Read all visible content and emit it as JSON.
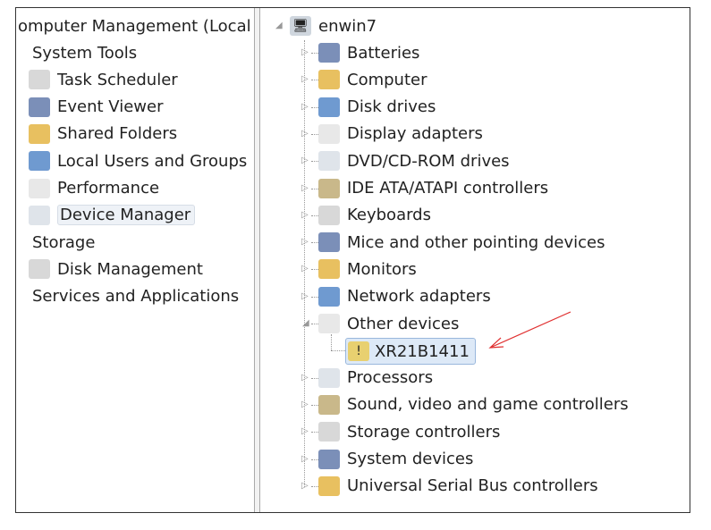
{
  "left_tree": {
    "root": "omputer Management (Local",
    "items": [
      {
        "label": "System Tools",
        "level": 0,
        "icon": "tools-icon"
      },
      {
        "label": "Task Scheduler",
        "level": 1,
        "icon": "clock-icon"
      },
      {
        "label": "Event Viewer",
        "level": 1,
        "icon": "event-viewer-icon"
      },
      {
        "label": "Shared Folders",
        "level": 1,
        "icon": "shared-folder-icon"
      },
      {
        "label": "Local Users and Groups",
        "level": 1,
        "icon": "users-icon"
      },
      {
        "label": "Performance",
        "level": 1,
        "icon": "performance-icon"
      },
      {
        "label": "Device Manager",
        "level": 1,
        "icon": "device-manager-icon",
        "selected": true
      },
      {
        "label": "Storage",
        "level": 0,
        "icon": "storage-icon"
      },
      {
        "label": "Disk Management",
        "level": 1,
        "icon": "disk-icon"
      },
      {
        "label": "Services and Applications",
        "level": 0,
        "icon": "services-icon"
      }
    ]
  },
  "device_tree": {
    "root": "enwin7",
    "categories": [
      {
        "label": "Batteries",
        "icon": "battery-icon"
      },
      {
        "label": "Computer",
        "icon": "computer-icon"
      },
      {
        "label": "Disk drives",
        "icon": "disk-drive-icon"
      },
      {
        "label": "Display adapters",
        "icon": "display-adapter-icon"
      },
      {
        "label": "DVD/CD-ROM drives",
        "icon": "dvd-icon"
      },
      {
        "label": "IDE ATA/ATAPI controllers",
        "icon": "ide-icon"
      },
      {
        "label": "Keyboards",
        "icon": "keyboard-icon"
      },
      {
        "label": "Mice and other pointing devices",
        "icon": "mouse-icon"
      },
      {
        "label": "Monitors",
        "icon": "monitor-icon"
      },
      {
        "label": "Network adapters",
        "icon": "network-icon"
      },
      {
        "label": "Other devices",
        "icon": "unknown-device-icon",
        "expanded": true
      },
      {
        "label": "Processors",
        "icon": "processor-icon"
      },
      {
        "label": "Sound, video and game controllers",
        "icon": "sound-icon"
      },
      {
        "label": "Storage controllers",
        "icon": "storage-controller-icon"
      },
      {
        "label": "System devices",
        "icon": "system-device-icon"
      },
      {
        "label": "Universal Serial Bus controllers",
        "icon": "usb-icon"
      }
    ],
    "other_child": "XR21B1411"
  },
  "colors": {
    "arrow": "#e03030",
    "highlight": "#dde9f7"
  }
}
